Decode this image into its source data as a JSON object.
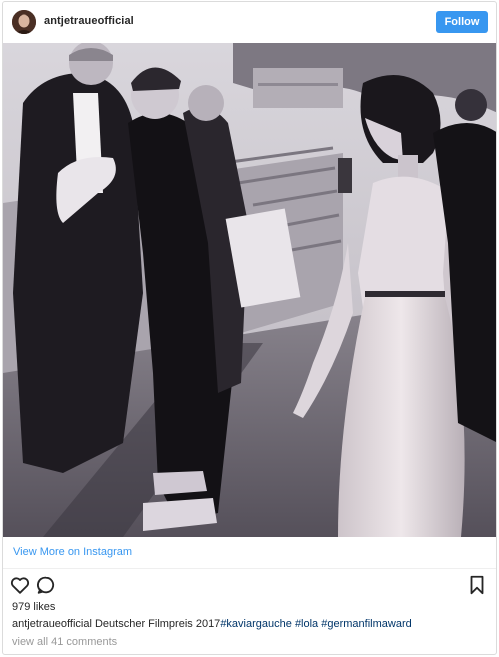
{
  "header": {
    "username": "antjetraueofficial",
    "follow_label": "Follow",
    "avatar_icon": "profile-avatar"
  },
  "post": {
    "photo_description_icon": "photo",
    "view_more_label": "View More on Instagram",
    "likes": "979 likes",
    "caption": {
      "username": "antjetraueofficial",
      "text": "Deutscher Filmpreis 2017",
      "tags": [
        "#kaviargauche",
        "#lola",
        "#germanfilmaward"
      ]
    },
    "comments_link": "view all 41 comments"
  },
  "icons": {
    "like": "heart-icon",
    "comment": "comment-icon",
    "save": "bookmark-icon"
  },
  "colors": {
    "accent": "#3897f0",
    "tag": "#003569",
    "muted": "#999999"
  }
}
